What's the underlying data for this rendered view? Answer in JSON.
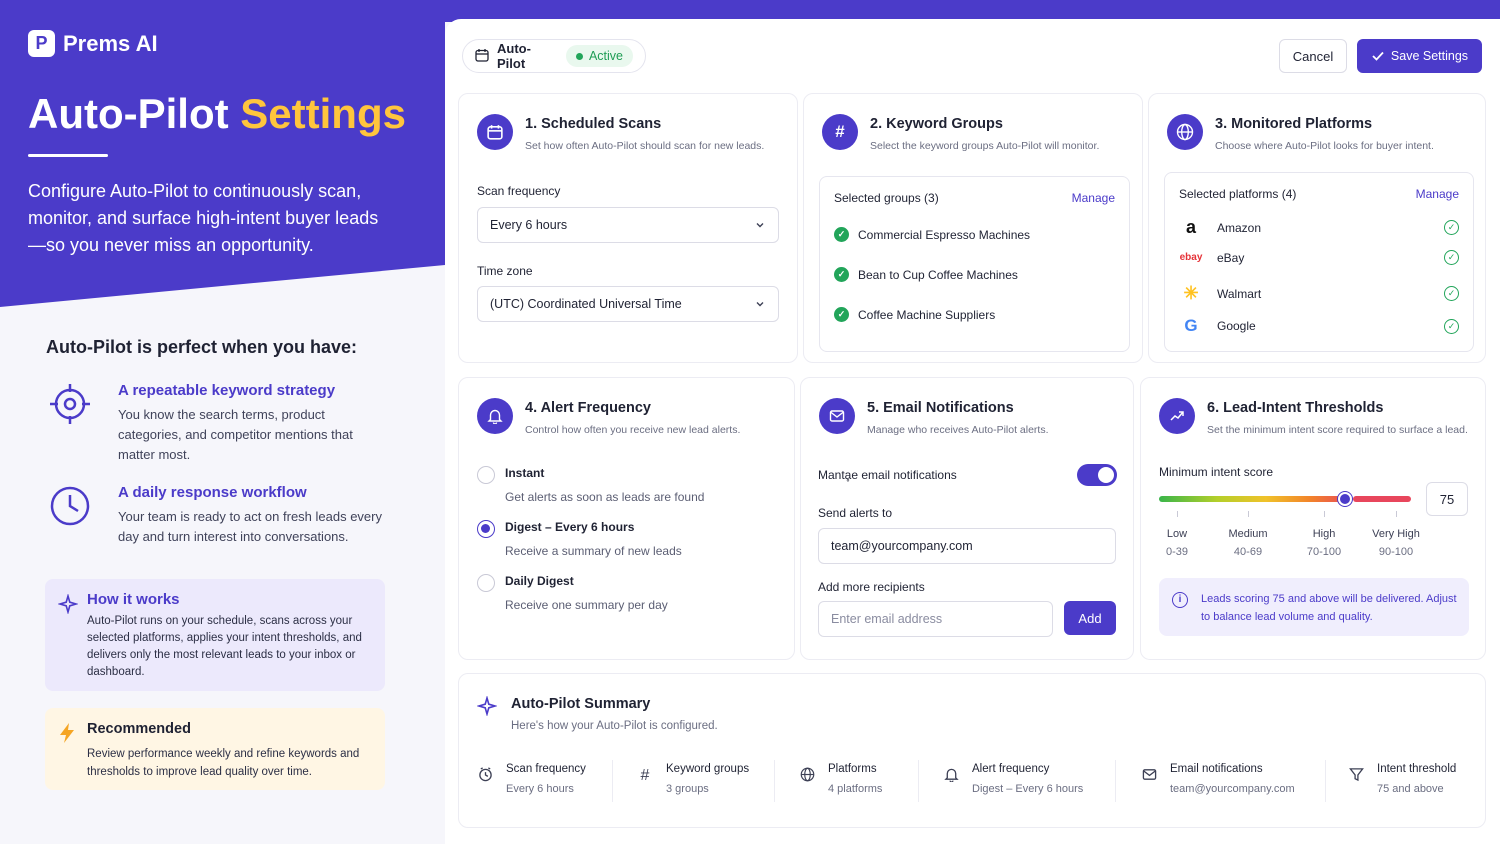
{
  "brand": {
    "name": "Prems AI",
    "logo_letter": "P"
  },
  "hero": {
    "title_a": "Auto-Pilot",
    "title_b": "Settings",
    "description": "Configure Auto-Pilot to continuously scan, monitor, and surface high-intent buyer leads—so you never miss an opportunity."
  },
  "perfect": {
    "title": "Auto-Pilot is perfect when you have:",
    "items": [
      {
        "title": "A repeatable keyword strategy",
        "desc": "You know the search terms, product categories, and competitor mentions that matter most.",
        "icon": "crosshair-icon"
      },
      {
        "title": "A daily response workflow",
        "desc": "Your team is ready to act on fresh leads every day and turn interest into conversations.",
        "icon": "clock-icon"
      }
    ]
  },
  "how": {
    "title": "How it works",
    "desc": "Auto-Pilot runs on your schedule, scans across your selected platforms, applies your intent thresholds, and delivers only the most relevant leads to your inbox or dashboard."
  },
  "recommended": {
    "title": "Recommended",
    "desc": "Review performance weekly and refine keywords and thresholds to improve lead quality over time."
  },
  "topbar": {
    "name": "Auto-Pilot",
    "status": "Active",
    "cancel": "Cancel",
    "save": "Save Settings"
  },
  "scans": {
    "title": "1. Scheduled Scans",
    "subtitle": "Set how often Auto-Pilot should scan for new leads.",
    "freq_label": "Scan frequency",
    "freq_value": "Every 6 hours",
    "tz_label": "Time zone",
    "tz_value": "(UTC) Coordinated Universal Time"
  },
  "keywords": {
    "title": "2. Keyword Groups",
    "subtitle": "Select the keyword groups Auto-Pilot will monitor.",
    "selected": "Selected groups (3)",
    "manage": "Manage",
    "groups": [
      "Commercial Espresso Machines",
      "Bean to Cup Coffee Machines",
      "Coffee Machine Suppliers"
    ]
  },
  "platforms": {
    "title": "3. Monitored Platforms",
    "subtitle": "Choose where Auto-Pilot looks for buyer intent.",
    "selected": "Selected platforms (4)",
    "manage": "Manage",
    "items": [
      {
        "name": "Amazon",
        "logo": "a"
      },
      {
        "name": "eBay",
        "logo": "ebay"
      },
      {
        "name": "Walmart",
        "logo": "✳"
      },
      {
        "name": "Google",
        "logo": "G"
      }
    ]
  },
  "alerts": {
    "title": "4. Alert Frequency",
    "subtitle": "Control how often you receive new lead alerts.",
    "options": [
      {
        "title": "Instant",
        "desc": "Get alerts as soon as leads are found",
        "selected": false
      },
      {
        "title": "Digest – Every 6 hours",
        "desc": "Receive a summary of new leads",
        "selected": true
      },
      {
        "title": "Daily Digest",
        "desc": "Receive one summary per day",
        "selected": false
      }
    ]
  },
  "email": {
    "title": "5. Email Notifications",
    "subtitle": "Manage who receives Auto-Pilot alerts.",
    "toggle_label": "Mantḁe email notifications",
    "toggle_on": true,
    "send_label": "Send alerts to",
    "send_value": "team@yourcompany.com",
    "more_label": "Add more recipients",
    "placeholder": "Enter email address",
    "add": "Add"
  },
  "thresholds": {
    "title": "6. Lead-Intent Thresholds",
    "subtitle": "Set the minimum intent score required to surface a lead.",
    "min_label": "Minimum intent score",
    "value": "75",
    "value_num": 75,
    "levels": [
      {
        "name": "Low",
        "range": "0-39"
      },
      {
        "name": "Medium",
        "range": "40-69"
      },
      {
        "name": "High",
        "range": "70-100"
      },
      {
        "name": "Very High",
        "range": "90-100"
      }
    ],
    "info": "Leads scoring 75 and above will be delivered. Adjust to balance lead volume and quality."
  },
  "summary": {
    "title": "Auto-Pilot Summary",
    "subtitle": "Here's how your Auto-Pilot is configured.",
    "items": [
      {
        "label": "Scan frequency",
        "value": "Every 6 hours",
        "icon": "clock-icon"
      },
      {
        "label": "Keyword groups",
        "value": "3 groups",
        "icon": "hash-icon"
      },
      {
        "label": "Platforms",
        "value": "4 platforms",
        "icon": "globe-icon"
      },
      {
        "label": "Alert frequency",
        "value": "Digest – Every 6 hours",
        "icon": "bell-icon"
      },
      {
        "label": "Email notifications",
        "value": "team@yourcompany.com",
        "icon": "mail-icon"
      },
      {
        "label": "Intent threshold",
        "value": "75 and above",
        "icon": "funnel-icon"
      }
    ]
  },
  "colors": {
    "primary": "#4b3bc9",
    "accent": "#ffc53d",
    "success": "#22a55a"
  }
}
